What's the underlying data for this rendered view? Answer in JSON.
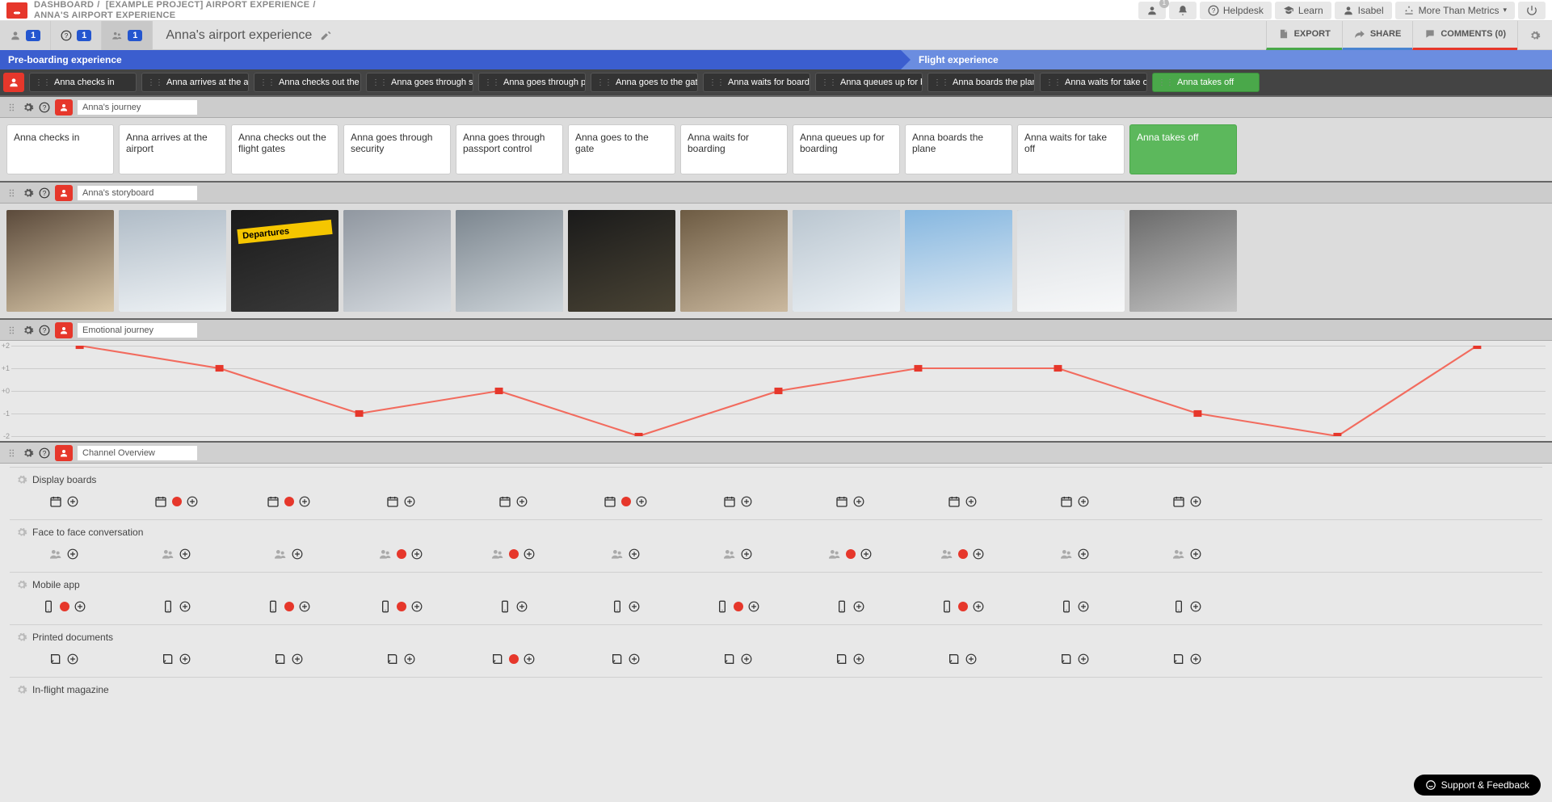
{
  "breadcrumb": {
    "dashboard": "DASHBOARD",
    "project": "[EXAMPLE PROJECT] AIRPORT EXPERIENCE",
    "map": "ANNA'S AIRPORT EXPERIENCE"
  },
  "header": {
    "helpdesk": "Helpdesk",
    "learn": "Learn",
    "user": "Isabel",
    "org": "More Than Metrics",
    "notif_count": "1"
  },
  "toolbar": {
    "count1": "1",
    "count2": "1",
    "count3": "1",
    "title": "Anna's airport experience",
    "export": "EXPORT",
    "share": "SHARE",
    "comments": "COMMENTS (0)"
  },
  "phases": {
    "p1": "Pre-boarding experience",
    "p2": "Flight experience"
  },
  "steps": [
    "Anna checks in",
    "Anna arrives at the air...",
    "Anna checks out the fli...",
    "Anna goes through sec...",
    "Anna goes through pa...",
    "Anna goes to the gate",
    "Anna waits for boarding",
    "Anna queues up for bo...",
    "Anna boards the plane",
    "Anna waits for take off",
    "Anna takes off"
  ],
  "lanes": {
    "journey": "Anna's journey",
    "storyboard": "Anna's storyboard",
    "emotional": "Emotional journey",
    "channels": "Channel Overview"
  },
  "journey_cards": [
    "Anna checks in",
    "Anna arrives at the airport",
    "Anna checks out the flight gates",
    "Anna goes through security",
    "Anna goes through passport control",
    "Anna goes to the gate",
    "Anna waits for boarding",
    "Anna queues up for boarding",
    "Anna boards the plane",
    "Anna waits for take off",
    "Anna takes off"
  ],
  "chart_data": {
    "type": "line",
    "title": "Emotional journey",
    "xlabel": "",
    "ylabel": "",
    "ylim": [
      -2,
      2
    ],
    "categories": [
      "Anna checks in",
      "Anna arrives at the airport",
      "Anna checks out the flight gates",
      "Anna goes through security",
      "Anna goes through passport control",
      "Anna goes to the gate",
      "Anna waits for boarding",
      "Anna queues up for boarding",
      "Anna boards the plane",
      "Anna waits for take off",
      "Anna takes off"
    ],
    "values": [
      2,
      1,
      -1,
      0,
      -2,
      0,
      1,
      1,
      -1,
      -2,
      2
    ],
    "y_ticks": [
      "+2",
      "+1",
      "+0",
      "-1",
      "-2"
    ]
  },
  "channels": [
    {
      "name": "Display boards",
      "icon": "calendar",
      "active": [
        false,
        true,
        true,
        false,
        false,
        true,
        false,
        false,
        false,
        false,
        false
      ]
    },
    {
      "name": "Face to face conversation",
      "icon": "people",
      "active": [
        false,
        false,
        false,
        true,
        true,
        false,
        false,
        true,
        true,
        false,
        false
      ]
    },
    {
      "name": "Mobile app",
      "icon": "phone",
      "active": [
        true,
        false,
        true,
        true,
        false,
        false,
        true,
        false,
        true,
        false,
        false
      ]
    },
    {
      "name": "Printed documents",
      "icon": "book",
      "active": [
        false,
        false,
        false,
        false,
        true,
        false,
        false,
        false,
        false,
        false,
        false
      ]
    },
    {
      "name": "In-flight magazine",
      "icon": "magazine",
      "active": []
    }
  ],
  "support": "Support & Feedback"
}
